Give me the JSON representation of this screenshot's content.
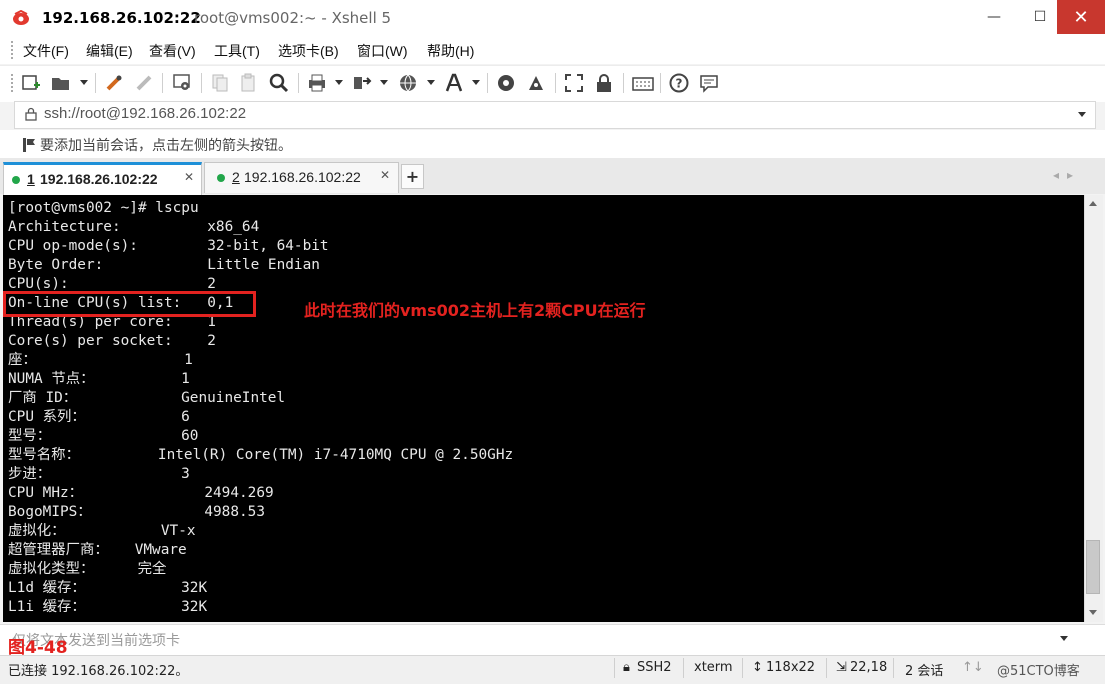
{
  "window": {
    "title_host": "192.168.26.102:22",
    "title_rest": "root@vms002:~ - Xshell 5",
    "min_label": "—",
    "max_label": "☐",
    "close_label": "✕"
  },
  "menu": [
    "文件(F)",
    "编辑(E)",
    "查看(V)",
    "工具(T)",
    "选项卡(B)",
    "窗口(W)",
    "帮助(H)"
  ],
  "address": {
    "value": "ssh://root@192.168.26.102:22"
  },
  "hint": {
    "text": "要添加当前会话，点击左侧的箭头按钮。"
  },
  "tabs": [
    {
      "num": "1",
      "label": "192.168.26.102:22",
      "status": "connected"
    },
    {
      "num": "2",
      "label": "192.168.26.102:22",
      "status": "connected"
    }
  ],
  "tab_add": "+",
  "terminal": {
    "lines": [
      "[root@vms002 ~]# lscpu",
      "Architecture:          x86_64",
      "CPU op-mode(s):        32-bit, 64-bit",
      "Byte Order:            Little Endian",
      "CPU(s):                2",
      "On-line CPU(s) list:   0,1",
      "Thread(s) per core:    1",
      "Core(s) per socket:    2",
      "座：                 1",
      "NUMA 节点：          1",
      "厂商 ID：            GenuineIntel",
      "CPU 系列：           6",
      "型号：               60",
      "型号名称：         Intel(R) Core(TM) i7-4710MQ CPU @ 2.50GHz",
      "步进：               3",
      "CPU MHz：              2494.269",
      "BogoMIPS：             4988.53",
      "虚拟化：           VT-x",
      "超管理器厂商：   VMware",
      "虚拟化类型：     完全",
      "L1d 缓存：           32K",
      "L1i 缓存：           32K"
    ],
    "annotation": "此时在我们的vms002主机上有2颗CPU在运行",
    "text_color": "#e8e8e8",
    "background": "#000000"
  },
  "input": {
    "placeholder": "仅将文本发送到当前选项卡",
    "figure_label": "图4-48"
  },
  "status": {
    "connection": "已连接 192.168.26.102:22。",
    "protocol": "SSH2",
    "terminal_type": "xterm",
    "size": "118x22",
    "cursor": "22,18",
    "sessions": "2 会话",
    "watermark": "@51CTO博客"
  },
  "colors": {
    "accent": "#1e90d8",
    "annotation": "#e3221f",
    "close": "#c8372e",
    "status_dot": "#22a64a"
  }
}
